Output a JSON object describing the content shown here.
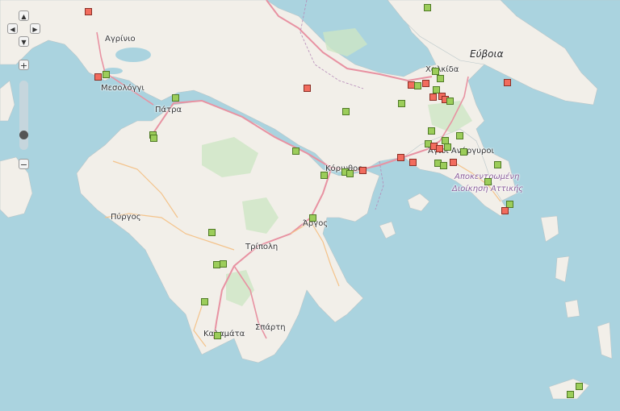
{
  "map": {
    "labels": {
      "agrinio": "Αγρίνιο",
      "mesolongi": "Μεσολόγγι",
      "patra": "Πάτρα",
      "pyrgos": "Πύργος",
      "tripoli": "Τρίπολη",
      "argos": "Άργος",
      "korinthos": "Κόρινθος",
      "sparti": "Σπάρτη",
      "kalamata": "Καλαμάτα",
      "chalkida": "Χαλκίδα",
      "evia": "Εύβοια",
      "agioi_anargyroi": "Άγιοι Ανάργυροι",
      "attica_1": "Αποκεντρωμένη",
      "attica_2": "Διοίκηση Αττικής"
    },
    "controls": {
      "pan_up": "▲",
      "pan_left": "◀",
      "pan_right": "▶",
      "pan_down": "▼",
      "zoom_in": "+",
      "zoom_out": "−"
    },
    "marker_colors": {
      "green": "#9ccd5a",
      "red": "#f26c5e"
    }
  }
}
